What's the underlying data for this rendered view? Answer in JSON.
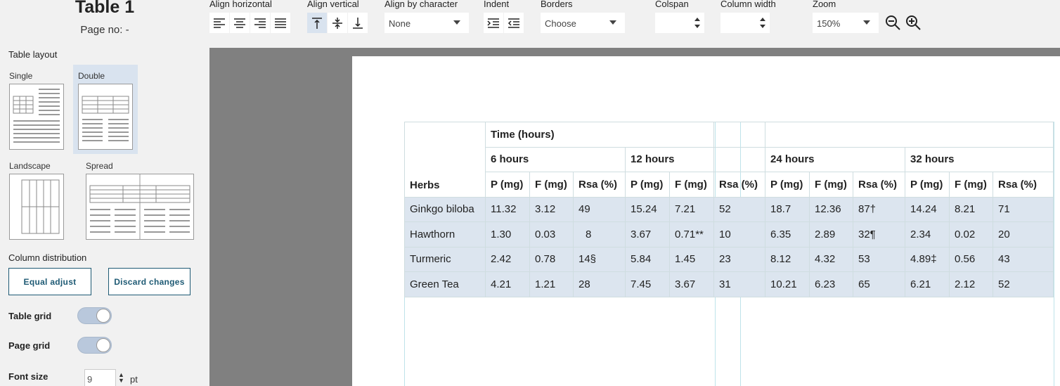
{
  "sidebar": {
    "title": "Table 1",
    "page_no": "Page no: -",
    "table_layout_label": "Table layout",
    "layouts": [
      {
        "label": "Single",
        "selected": false
      },
      {
        "label": "Double",
        "selected": true
      },
      {
        "label": "Landscape",
        "selected": false
      },
      {
        "label": "Spread",
        "selected": false
      }
    ],
    "column_distribution_label": "Column distribution",
    "equal_adjust_label": "Equal adjust",
    "discard_changes_label": "Discard changes",
    "table_grid_label": "Table grid",
    "table_grid_on": true,
    "page_grid_label": "Page grid",
    "page_grid_on": true,
    "font_size_label": "Font size",
    "font_size_value": "9",
    "font_size_unit": "pt"
  },
  "toolbar": {
    "align_horizontal_label": "Align horizontal",
    "align_vertical_label": "Align vertical",
    "align_by_character_label": "Align by character",
    "align_by_character_value": "None",
    "indent_label": "Indent",
    "borders_label": "Borders",
    "borders_value": "Choose",
    "colspan_label": "Colspan",
    "colspan_value": "",
    "column_width_label": "Column width",
    "column_width_value": "",
    "zoom_label": "Zoom",
    "zoom_value": "150%"
  },
  "table": {
    "herbs_header": "Herbs",
    "time_header": "Time (hours)",
    "groups": [
      "6 hours",
      "12 hours",
      "24 hours",
      "32 hours"
    ],
    "col_headers": [
      "P (mg)",
      "F (mg)",
      "Rsa (%)"
    ],
    "rows": [
      {
        "herb": "Ginkgo biloba",
        "values": [
          "11.32",
          "3.12",
          "49",
          "15.24",
          "7.21",
          "52",
          "18.7",
          "12.36",
          "87†",
          "14.24",
          "8.21",
          "71"
        ]
      },
      {
        "herb": "Hawthorn",
        "values": [
          "1.30",
          "0.03",
          "8",
          "3.67",
          "0.71**",
          "10",
          "6.35",
          "2.89",
          "32¶",
          "2.34",
          "0.02",
          "20"
        ]
      },
      {
        "herb": "Turmeric",
        "values": [
          "2.42",
          "0.78",
          "14§",
          "5.84",
          "1.45",
          "23",
          "8.12",
          "4.32",
          "53",
          "4.89‡",
          "0.56",
          "43"
        ]
      },
      {
        "herb": "Green Tea",
        "values": [
          "4.21",
          "1.21",
          "28",
          "7.45",
          "3.67",
          "31",
          "10.21",
          "6.23",
          "65",
          "6.21",
          "2.12",
          "52"
        ]
      }
    ]
  },
  "colors": {
    "accent": "#1e5a74",
    "selection": "#dce5ef",
    "canvas": "#808080"
  }
}
